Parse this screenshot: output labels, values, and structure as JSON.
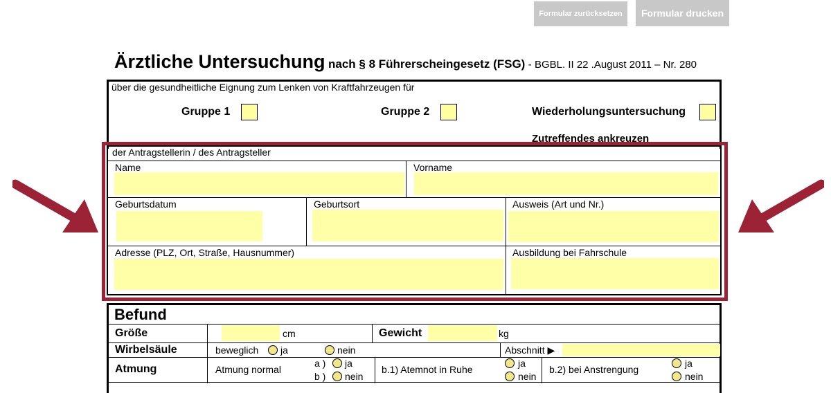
{
  "buttons": {
    "reset_label": "Formular zurücksetzen",
    "print_label": "Formular drucken"
  },
  "header": {
    "title": "Ärztliche Untersuchung",
    "subtitle": "nach § 8 Führerscheingesetz (FSG)",
    "reference": "- BGBL. II 22 .August 2011 – Nr. 280"
  },
  "eligibility": {
    "intro": "über die gesundheitliche Eignung zum Lenken von Kraftfahrzeugen für",
    "group1": "Gruppe 1",
    "group2": "Gruppe 2",
    "repeat": "Wiederholungsuntersuchung",
    "hint": "Zutreffendes ankreuzen"
  },
  "applicant": {
    "heading": "der Antragstellerin / des Antragsteller",
    "name_label": "Name",
    "vorname_label": "Vorname",
    "geburtsdatum_label": "Geburtsdatum",
    "geburtsort_label": "Geburtsort",
    "ausweis_label": "Ausweis (Art und Nr.)",
    "adresse_label": "Adresse (PLZ, Ort, Straße, Hausnummer)",
    "ausbildung_label": "Ausbildung bei Fahrschule"
  },
  "befund": {
    "heading": "Befund",
    "groesse_label": "Größe",
    "groesse_unit": "cm",
    "gewicht_label": "Gewicht",
    "gewicht_unit": "kg",
    "wirbelsaeule_label": "Wirbelsäule",
    "beweglich_label": "beweglich",
    "ja": "ja",
    "nein": "nein",
    "abschnitt_label": "Abschnitt ▶",
    "atmung_label": "Atmung",
    "atmung_normal_label": "Atmung normal",
    "option_a": "a )",
    "option_b": "b )",
    "b1_label": "b.1) Atemnot in Ruhe",
    "b2_label": "b.2) bei Anstrengung"
  },
  "colors": {
    "highlight_frame": "#9b2335",
    "field_fill": "#ffffa8",
    "button_fill": "#c8c8c8"
  }
}
